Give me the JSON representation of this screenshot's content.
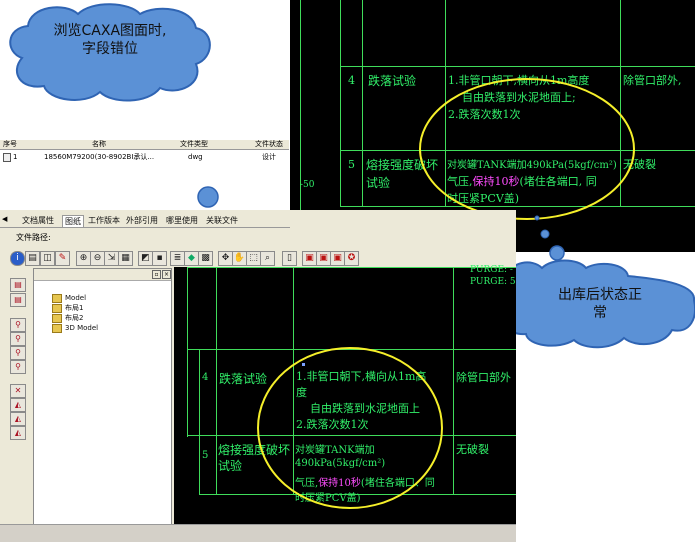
{
  "top_cloud": {
    "line1": "浏览CAXA图面时,",
    "line2": "字段错位"
  },
  "bottom_cloud": {
    "line1": "出库后状态正",
    "line2": "常"
  },
  "file_list": {
    "headers": [
      "序号",
      "名称",
      "文件类型",
      "文件状态"
    ],
    "row": {
      "index": "1",
      "name": "18560M79200(30-8902BI承认...",
      "type": "dwg",
      "status": "设计"
    }
  },
  "tabs": [
    "文档属性",
    "图纸",
    "工作版本",
    "外部引用",
    "哪里使用",
    "关联文件"
  ],
  "path_label": "文件路径:",
  "tree": [
    "Model",
    "布局1",
    "布局2",
    "3D Model"
  ],
  "top_drawing": {
    "axis_label": "-50",
    "row4_no": "4",
    "row4_item": "跌落试验",
    "row4_desc1": "1.非管口朝下,横向从1m高度",
    "row4_desc2": "自由跌落到水泥地面上;",
    "row4_desc3": "2.跌落次数1次",
    "row4_result": "除管口部外,",
    "row5_no": "5",
    "row5_item1": "熔接强度破坏",
    "row5_item2": "试验",
    "row5_desc1": "对炭罐TANK端加490kPa(5kgf/cm²)",
    "row5_desc2a": "气压,",
    "row5_desc2b": "保持10秒",
    "row5_desc2c": "(堵住各端口, 同",
    "row5_desc3": "时压紧PCV盖)",
    "row5_result": "无破裂"
  },
  "bottom_drawing": {
    "purge1": "PURGE: -",
    "purge2": "PURGE: 5",
    "row4_no": "4",
    "row4_item": "跌落试验",
    "row4_desc1": "1.非管口朝下,横向从1m高",
    "row4_desc1b": "度",
    "row4_desc2": "自由跌落到水泥地面上",
    "row4_desc3": "2.跌落次数1次",
    "row4_result": "除管口部外",
    "row5_no": "5",
    "row5_item1": "熔接强度破坏",
    "row5_item2": "试验",
    "row5_desc1": "对炭罐TANK端加",
    "row5_desc2": "490kPa(5kgf/cm²)",
    "row5_desc3a": "气压,",
    "row5_desc3b": "保持10秒",
    "row5_desc3c": "(堵住各端口、同",
    "row5_desc4": "时压紧PCV盖)",
    "row5_result": "无破裂"
  },
  "colors": {
    "cad_bg": "#000000",
    "cad_text": "#31f06a",
    "cad_line": "#3fdc5a",
    "highlight": "#ff4dff",
    "circle": "#f5ef2a",
    "cloud": "#5b91d6"
  }
}
